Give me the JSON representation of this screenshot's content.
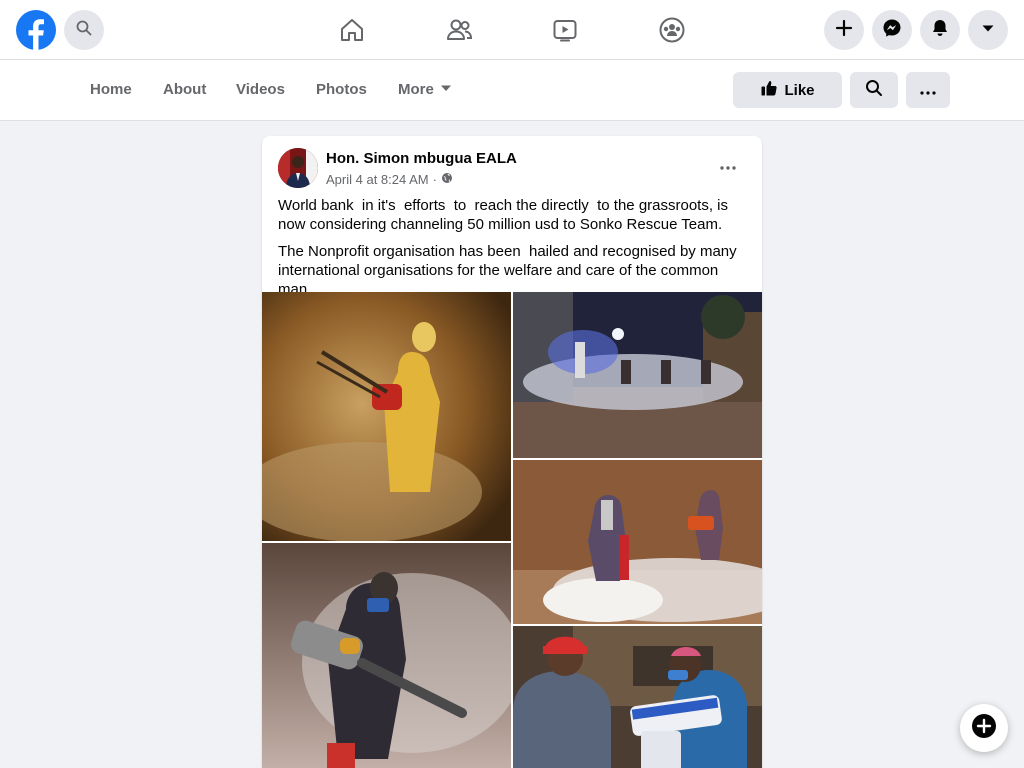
{
  "topbar": {
    "logo_icon": "facebook-logo-icon",
    "search_icon": "search-icon",
    "nav_icons": [
      "home-icon",
      "friends-icon",
      "watch-icon",
      "groups-icon"
    ],
    "action_icons": [
      "plus-icon",
      "messenger-icon",
      "notifications-icon",
      "account-dropdown-icon"
    ]
  },
  "page_nav": {
    "tabs": [
      "Home",
      "About",
      "Videos",
      "Photos"
    ],
    "more_label": "More",
    "like_label": "Like"
  },
  "post": {
    "author": "Hon. Simon mbugua EALA",
    "date": "April 4 at 8:24 AM",
    "separator": "·",
    "paragraphs": [
      "World bank  in it's  efforts  to  reach the directly  to the grassroots, is now considering channeling 50 million usd to Sonko Rescue Team.",
      "The Nonprofit organisation has been  hailed and recognised by many international organisations for the welfare and care of the common man."
    ],
    "photos": [
      "person-fogging-in-yellow-suit",
      "team-fogging-street-at-night",
      "two-workers-fogging-yard",
      "worker-with-fogging-machine",
      "food-distribution-handover"
    ]
  },
  "colors": {
    "brand": "#1877f2",
    "background": "#f0f2f5",
    "secondary_text": "#65676b",
    "button_gray": "#e4e6eb"
  }
}
